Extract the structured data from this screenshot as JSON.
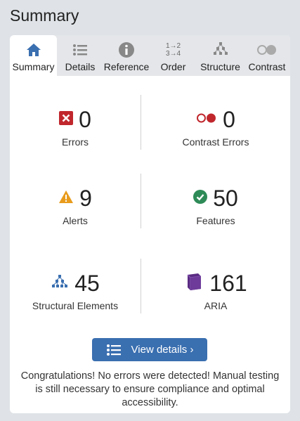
{
  "page": {
    "title": "Summary"
  },
  "tabs": [
    {
      "label": "Summary",
      "icon": "home-icon",
      "active": true
    },
    {
      "label": "Details",
      "icon": "list-icon",
      "active": false
    },
    {
      "label": "Reference",
      "icon": "info-icon",
      "active": false
    },
    {
      "label": "Order",
      "icon": "order-icon",
      "active": false
    },
    {
      "label": "Structure",
      "icon": "structure-icon",
      "active": false
    },
    {
      "label": "Contrast",
      "icon": "contrast-icon",
      "active": false
    }
  ],
  "order_icon_text": {
    "top": "1→2",
    "bottom": "3→4"
  },
  "stats": {
    "errors": {
      "value": "0",
      "label": "Errors",
      "color": "#c0272d"
    },
    "contrast_errors": {
      "value": "0",
      "label": "Contrast Errors",
      "color": "#c0272d"
    },
    "alerts": {
      "value": "9",
      "label": "Alerts",
      "color": "#e89b1c"
    },
    "features": {
      "value": "50",
      "label": "Features",
      "color": "#2e8b57"
    },
    "structural": {
      "value": "45",
      "label": "Structural Elements",
      "color": "#3a6fb0"
    },
    "aria": {
      "value": "161",
      "label": "ARIA",
      "color": "#5b2c83"
    }
  },
  "button": {
    "label": "View details ›"
  },
  "message": "Congratulations! No errors were detected! Manual testing is still necessary to ensure compliance and optimal accessibility."
}
